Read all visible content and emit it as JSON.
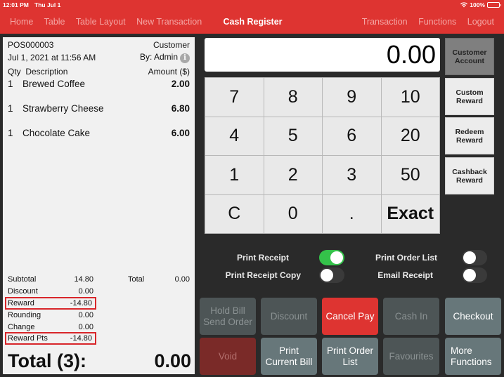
{
  "status_bar": {
    "time": "12:01 PM",
    "date": "Thu Jul 1",
    "battery": "100%",
    "wifi_icon": "wifi-icon",
    "battery_icon": "battery-icon"
  },
  "nav": {
    "left": [
      "Home",
      "Table",
      "Table Layout",
      "New Transaction"
    ],
    "title": "Cash Register",
    "right": [
      "Transaction",
      "Functions",
      "Logout"
    ]
  },
  "receipt": {
    "id": "POS000003",
    "customer_label": "Customer",
    "datetime": "Jul 1, 2021 at 11:56 AM",
    "by": "By: Admin",
    "info_icon": "i",
    "headers": {
      "qty": "Qty",
      "description": "Description",
      "amount": "Amount ($)"
    },
    "items": [
      {
        "qty": "1",
        "description": "Brewed Coffee",
        "amount": "2.00"
      },
      {
        "qty": "1",
        "description": "Strawberry Cheese",
        "amount": "6.80"
      },
      {
        "qty": "1",
        "description": "Chocolate Cake",
        "amount": "6.00"
      }
    ],
    "summary": [
      {
        "label": "Subtotal",
        "value": "14.80"
      },
      {
        "label": "Discount",
        "value": "0.00"
      },
      {
        "label": "Reward",
        "value": "-14.80"
      },
      {
        "label": "Rounding",
        "value": "0.00"
      },
      {
        "label": "Change",
        "value": "0.00"
      },
      {
        "label": "Reward Pts",
        "value": "-14.80"
      }
    ],
    "total_label": "Total",
    "total_value": "0.00",
    "grand_label": "Total (3):",
    "grand_value": "0.00"
  },
  "display": {
    "value": "0.00"
  },
  "keypad": [
    "7",
    "8",
    "9",
    "10",
    "4",
    "5",
    "6",
    "20",
    "1",
    "2",
    "3",
    "50",
    "C",
    "0",
    ".",
    "Exact"
  ],
  "side_buttons": [
    "Customer\nAccount",
    "Custom\nReward",
    "Redeem\nReward",
    "Cashback\nReward"
  ],
  "toggles": [
    {
      "label": "Print Receipt",
      "on": true
    },
    {
      "label": "Print Receipt Copy",
      "on": false
    },
    {
      "label": "Print Order List",
      "on": false
    },
    {
      "label": "Email Receipt",
      "on": false
    }
  ],
  "actions": {
    "hold_bill": "Hold Bill\nSend Order",
    "discount": "Discount",
    "cancel_pay": "Cancel Pay",
    "cash_in": "Cash In",
    "checkout": "Checkout",
    "void": "Void",
    "print_current_bill": "Print\nCurrent Bill",
    "print_order_list": "Print Order\nList",
    "favourites": "Favourites",
    "more_functions": "More\nFunctions"
  },
  "colors": {
    "brand": "#de3431",
    "toggle_on": "#34c24a",
    "highlight_box": "#d8262a"
  }
}
